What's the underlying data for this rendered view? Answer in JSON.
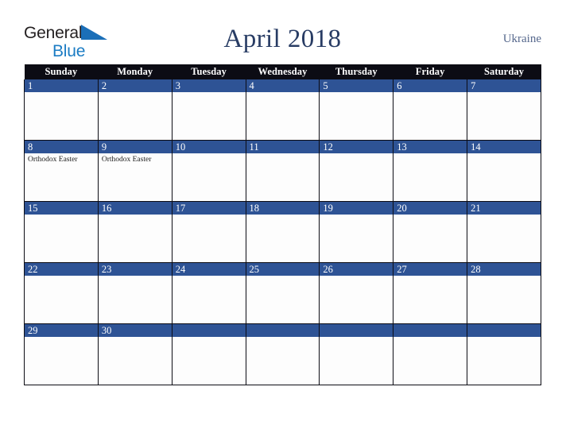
{
  "logo": {
    "text_top": "General",
    "text_bottom": "Blue",
    "triangle_icon": "blue-triangle-icon",
    "color_dark": "#231f20",
    "color_blue": "#1b7cc4"
  },
  "header": {
    "title": "April 2018",
    "country": "Ukraine",
    "title_color": "#283c64",
    "country_color": "#55678c"
  },
  "calendar": {
    "weekday_headers": [
      "Sunday",
      "Monday",
      "Tuesday",
      "Wednesday",
      "Thursday",
      "Friday",
      "Saturday"
    ],
    "header_bg": "#0c0c14",
    "daynum_bg": "#2e5395",
    "cell_bg": "#fdfdfd",
    "weeks": [
      [
        {
          "day": "1",
          "events": []
        },
        {
          "day": "2",
          "events": []
        },
        {
          "day": "3",
          "events": []
        },
        {
          "day": "4",
          "events": []
        },
        {
          "day": "5",
          "events": []
        },
        {
          "day": "6",
          "events": []
        },
        {
          "day": "7",
          "events": []
        }
      ],
      [
        {
          "day": "8",
          "events": [
            "Orthodox Easter"
          ]
        },
        {
          "day": "9",
          "events": [
            "Orthodox Easter"
          ]
        },
        {
          "day": "10",
          "events": []
        },
        {
          "day": "11",
          "events": []
        },
        {
          "day": "12",
          "events": []
        },
        {
          "day": "13",
          "events": []
        },
        {
          "day": "14",
          "events": []
        }
      ],
      [
        {
          "day": "15",
          "events": []
        },
        {
          "day": "16",
          "events": []
        },
        {
          "day": "17",
          "events": []
        },
        {
          "day": "18",
          "events": []
        },
        {
          "day": "19",
          "events": []
        },
        {
          "day": "20",
          "events": []
        },
        {
          "day": "21",
          "events": []
        }
      ],
      [
        {
          "day": "22",
          "events": []
        },
        {
          "day": "23",
          "events": []
        },
        {
          "day": "24",
          "events": []
        },
        {
          "day": "25",
          "events": []
        },
        {
          "day": "26",
          "events": []
        },
        {
          "day": "27",
          "events": []
        },
        {
          "day": "28",
          "events": []
        }
      ],
      [
        {
          "day": "29",
          "events": []
        },
        {
          "day": "30",
          "events": []
        },
        {
          "day": "",
          "events": []
        },
        {
          "day": "",
          "events": []
        },
        {
          "day": "",
          "events": []
        },
        {
          "day": "",
          "events": []
        },
        {
          "day": "",
          "events": []
        }
      ]
    ]
  }
}
